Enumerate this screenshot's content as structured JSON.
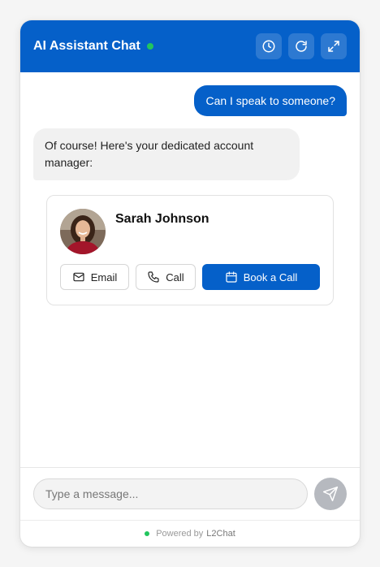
{
  "header": {
    "title": "AI Assistant Chat",
    "status": "online",
    "accent_color": "#0560c9",
    "status_color": "#22c55e",
    "buttons": [
      {
        "name": "history",
        "icon": "clock-icon"
      },
      {
        "name": "refresh",
        "icon": "refresh-icon"
      },
      {
        "name": "expand",
        "icon": "expand-icon"
      }
    ]
  },
  "messages": [
    {
      "role": "user",
      "text": "Can I speak to someone?"
    },
    {
      "role": "assistant",
      "text": "Of course! Here's your dedicated account manager:"
    }
  ],
  "contact": {
    "name": "Sarah Johnson",
    "actions": {
      "email": "Email",
      "call": "Call",
      "book": "Book a Call"
    }
  },
  "composer": {
    "placeholder": "Type a message...",
    "value": ""
  },
  "footer": {
    "powered_by": "Powered by",
    "brand": "L2Chat"
  }
}
